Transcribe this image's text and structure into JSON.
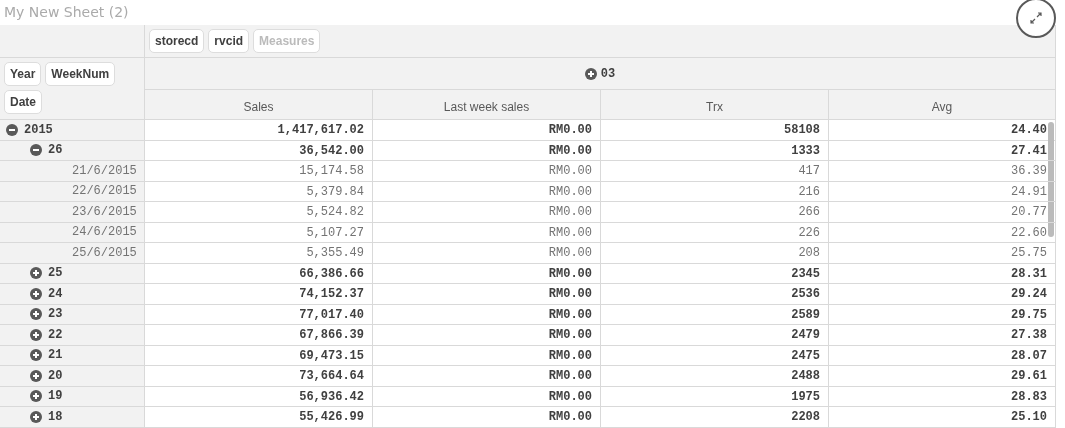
{
  "sheet_title": "My New Sheet (2)",
  "column_dimensions": [
    {
      "label": "storecd",
      "disabled": false
    },
    {
      "label": "rvcid",
      "disabled": false
    },
    {
      "label": "Measures",
      "disabled": true
    }
  ],
  "row_dimensions": [
    {
      "label": "Year"
    },
    {
      "label": "WeekNum"
    },
    {
      "label": "Date"
    }
  ],
  "column_group": {
    "label": "03",
    "expanded": false
  },
  "columns": [
    "Sales",
    "Last week sales",
    "Trx",
    "Avg"
  ],
  "rows": [
    {
      "kind": "year",
      "label": "2015",
      "expanded": true,
      "values": [
        "1,417,617.02",
        "RM0.00",
        "58108",
        "24.40"
      ],
      "children": [
        {
          "kind": "week",
          "label": "26",
          "expanded": true,
          "values": [
            "36,542.00",
            "RM0.00",
            "1333",
            "27.41"
          ],
          "children": [
            {
              "kind": "date",
              "label": "21/6/2015",
              "values": [
                "15,174.58",
                "RM0.00",
                "417",
                "36.39"
              ]
            },
            {
              "kind": "date",
              "label": "22/6/2015",
              "values": [
                "5,379.84",
                "RM0.00",
                "216",
                "24.91"
              ]
            },
            {
              "kind": "date",
              "label": "23/6/2015",
              "values": [
                "5,524.82",
                "RM0.00",
                "266",
                "20.77"
              ]
            },
            {
              "kind": "date",
              "label": "24/6/2015",
              "values": [
                "5,107.27",
                "RM0.00",
                "226",
                "22.60"
              ]
            },
            {
              "kind": "date",
              "label": "25/6/2015",
              "values": [
                "5,355.49",
                "RM0.00",
                "208",
                "25.75"
              ]
            }
          ]
        },
        {
          "kind": "week",
          "label": "25",
          "expanded": false,
          "values": [
            "66,386.66",
            "RM0.00",
            "2345",
            "28.31"
          ]
        },
        {
          "kind": "week",
          "label": "24",
          "expanded": false,
          "values": [
            "74,152.37",
            "RM0.00",
            "2536",
            "29.24"
          ]
        },
        {
          "kind": "week",
          "label": "23",
          "expanded": false,
          "values": [
            "77,017.40",
            "RM0.00",
            "2589",
            "29.75"
          ]
        },
        {
          "kind": "week",
          "label": "22",
          "expanded": false,
          "values": [
            "67,866.39",
            "RM0.00",
            "2479",
            "27.38"
          ]
        },
        {
          "kind": "week",
          "label": "21",
          "expanded": false,
          "values": [
            "69,473.15",
            "RM0.00",
            "2475",
            "28.07"
          ]
        },
        {
          "kind": "week",
          "label": "20",
          "expanded": false,
          "values": [
            "73,664.64",
            "RM0.00",
            "2488",
            "29.61"
          ]
        },
        {
          "kind": "week",
          "label": "19",
          "expanded": false,
          "values": [
            "56,936.42",
            "RM0.00",
            "1975",
            "28.83"
          ]
        },
        {
          "kind": "week",
          "label": "18",
          "expanded": false,
          "values": [
            "55,426.99",
            "RM0.00",
            "2208",
            "25.10"
          ]
        }
      ]
    }
  ]
}
